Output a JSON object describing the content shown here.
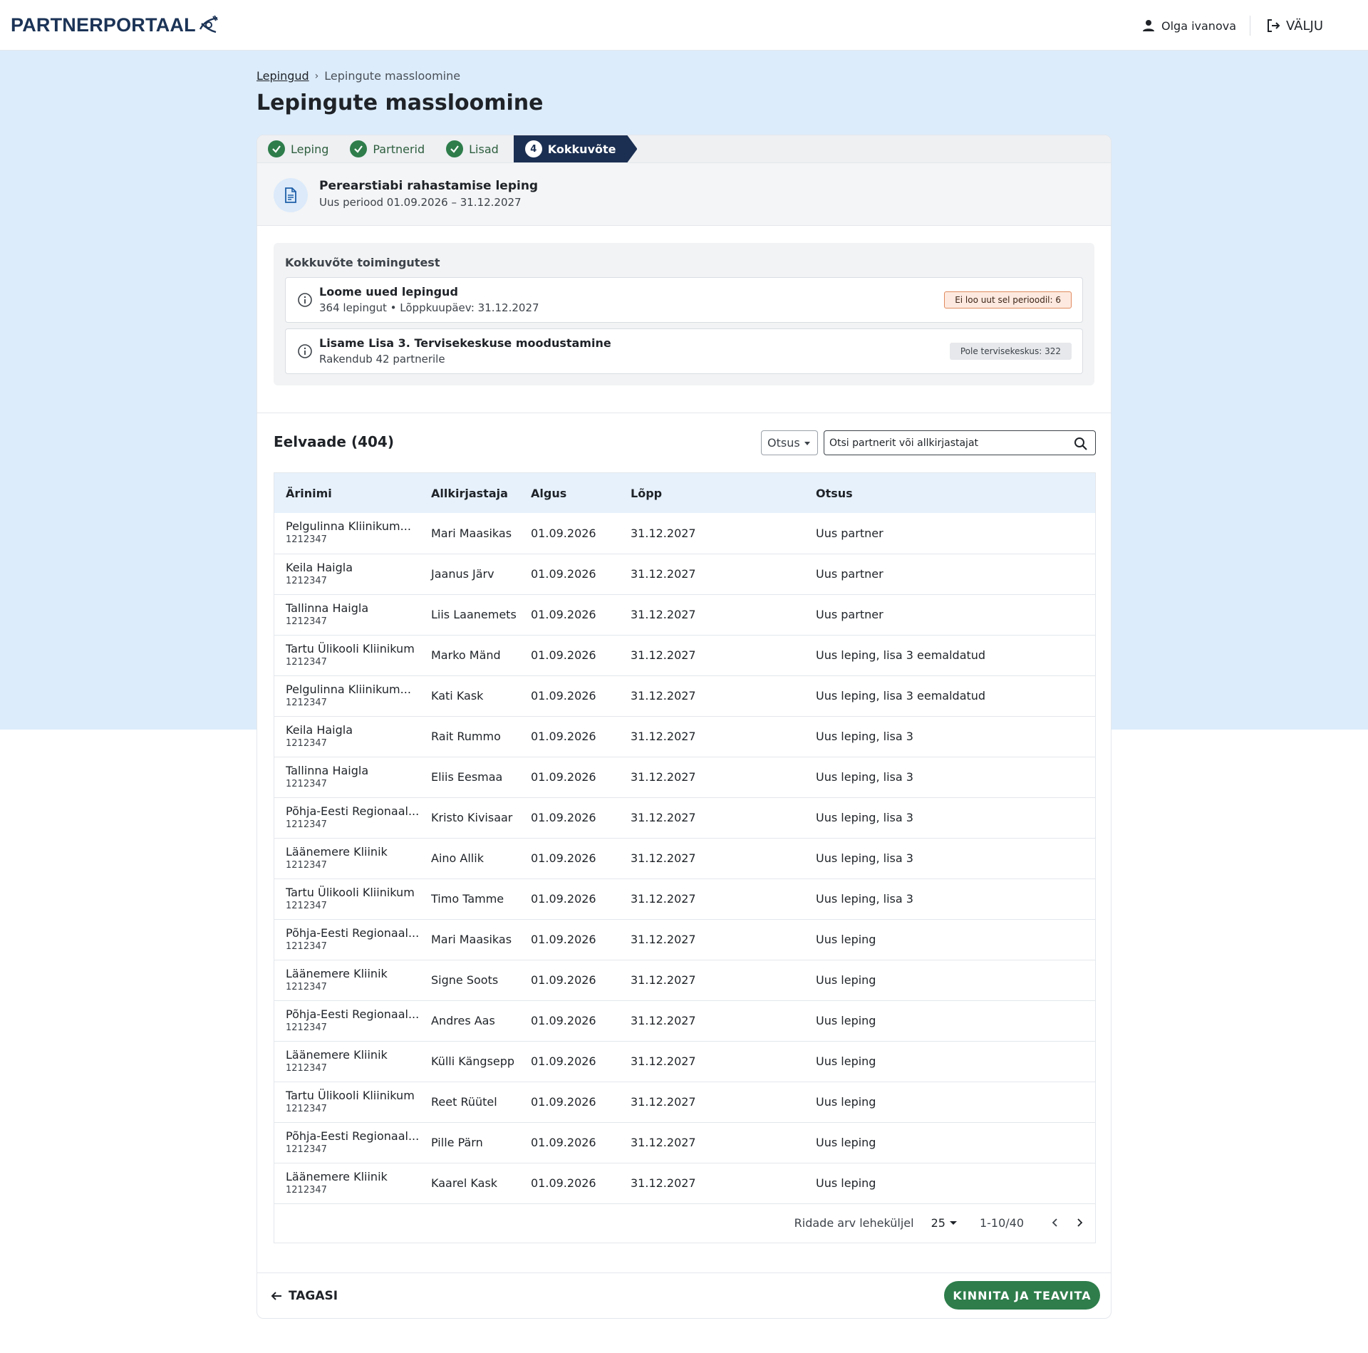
{
  "header": {
    "logo_text": "PARTNERPORTAAL",
    "user_name": "Olga ivanova",
    "logout_label": "VÄLJU"
  },
  "breadcrumb": {
    "parent": "Lepingud",
    "current": "Lepingute massloomine"
  },
  "page_title": "Lepingute massloomine",
  "stepper": {
    "steps": [
      {
        "label": "Leping",
        "state": "done"
      },
      {
        "label": "Partnerid",
        "state": "done"
      },
      {
        "label": "Lisad",
        "state": "done"
      },
      {
        "label": "Kokkuvõte",
        "state": "active",
        "number": "4"
      }
    ]
  },
  "contract": {
    "title": "Perearstiabi rahastamise leping",
    "period": "Uus periood 01.09.2026 – 31.12.2027"
  },
  "summary": {
    "title": "Kokkuvõte toimingutest",
    "items": [
      {
        "title": "Loome uued lepingud",
        "subtitle": "364 lepingut • Lõppkuupäev: 31.12.2027",
        "badge": "Ei loo uut sel perioodil: 6",
        "badge_type": "warn"
      },
      {
        "title": "Lisame Lisa 3. Tervisekeskuse moodustamine",
        "subtitle": "Rakendub 42 partnerile",
        "badge": "Pole tervisekeskus: 322",
        "badge_type": "neutral"
      }
    ]
  },
  "preview": {
    "title": "Eelvaade (404)",
    "filter_label": "Otsus",
    "search_placeholder": "Otsi partnerit või allkirjastajat"
  },
  "table": {
    "columns": [
      "Ärinimi",
      "Allkirjastaja",
      "Algus",
      "Lõpp",
      "Otsus"
    ],
    "rows": [
      {
        "name": "Pelgulinna Kliinikum...",
        "code": "1212347",
        "signer": "Mari Maasikas",
        "start": "01.09.2026",
        "end": "31.12.2027",
        "decision": "Uus partner"
      },
      {
        "name": "Keila Haigla",
        "code": "1212347",
        "signer": "Jaanus Järv",
        "start": "01.09.2026",
        "end": "31.12.2027",
        "decision": "Uus partner"
      },
      {
        "name": "Tallinna Haigla",
        "code": "1212347",
        "signer": "Liis Laanemets",
        "start": "01.09.2026",
        "end": "31.12.2027",
        "decision": "Uus partner"
      },
      {
        "name": "Tartu Ülikooli Kliinikum",
        "code": "1212347",
        "signer": "Marko Mänd",
        "start": "01.09.2026",
        "end": "31.12.2027",
        "decision": "Uus leping, lisa 3 eemaldatud"
      },
      {
        "name": "Pelgulinna Kliinikum...",
        "code": "1212347",
        "signer": "Kati Kask",
        "start": "01.09.2026",
        "end": "31.12.2027",
        "decision": "Uus leping, lisa 3 eemaldatud"
      },
      {
        "name": "Keila Haigla",
        "code": "1212347",
        "signer": "Rait Rummo",
        "start": "01.09.2026",
        "end": "31.12.2027",
        "decision": "Uus leping, lisa 3"
      },
      {
        "name": "Tallinna Haigla",
        "code": "1212347",
        "signer": "Eliis Eesmaa",
        "start": "01.09.2026",
        "end": "31.12.2027",
        "decision": "Uus leping, lisa 3"
      },
      {
        "name": "Põhja-Eesti Regionaal...",
        "code": "1212347",
        "signer": "Kristo Kivisaar",
        "start": "01.09.2026",
        "end": "31.12.2027",
        "decision": "Uus leping, lisa 3"
      },
      {
        "name": "Läänemere Kliinik",
        "code": "1212347",
        "signer": "Aino Allik",
        "start": "01.09.2026",
        "end": "31.12.2027",
        "decision": "Uus leping, lisa 3"
      },
      {
        "name": "Tartu Ülikooli Kliinikum",
        "code": "1212347",
        "signer": "Timo Tamme",
        "start": "01.09.2026",
        "end": "31.12.2027",
        "decision": "Uus leping, lisa 3"
      },
      {
        "name": "Põhja-Eesti Regionaal...",
        "code": "1212347",
        "signer": "Mari Maasikas",
        "start": "01.09.2026",
        "end": "31.12.2027",
        "decision": "Uus leping"
      },
      {
        "name": "Läänemere Kliinik",
        "code": "1212347",
        "signer": "Signe Soots",
        "start": "01.09.2026",
        "end": "31.12.2027",
        "decision": "Uus leping"
      },
      {
        "name": "Põhja-Eesti Regionaal...",
        "code": "1212347",
        "signer": "Andres Aas",
        "start": "01.09.2026",
        "end": "31.12.2027",
        "decision": "Uus leping"
      },
      {
        "name": "Läänemere Kliinik",
        "code": "1212347",
        "signer": "Külli Kängsepp",
        "start": "01.09.2026",
        "end": "31.12.2027",
        "decision": "Uus leping"
      },
      {
        "name": "Tartu Ülikooli Kliinikum",
        "code": "1212347",
        "signer": "Reet Rüütel",
        "start": "01.09.2026",
        "end": "31.12.2027",
        "decision": "Uus leping"
      },
      {
        "name": "Põhja-Eesti Regionaal...",
        "code": "1212347",
        "signer": "Pille Pärn",
        "start": "01.09.2026",
        "end": "31.12.2027",
        "decision": "Uus leping"
      },
      {
        "name": "Läänemere Kliinik",
        "code": "1212347",
        "signer": "Kaarel Kask",
        "start": "01.09.2026",
        "end": "31.12.2027",
        "decision": "Uus leping"
      }
    ]
  },
  "pagination": {
    "rows_label": "Ridade arv leheküljel",
    "rows_per_page": "25",
    "range": "1-10/40"
  },
  "footer": {
    "back_label": "TAGASI",
    "confirm_label": "KINNITA JA TEAVITA"
  },
  "colors": {
    "brand_navy": "#1b3356",
    "primary_green": "#2e7d4b",
    "hero_background": "#dcecfb",
    "warn_badge_border": "#e08a5e"
  },
  "icons": {
    "user": "person-icon",
    "logout": "logout-icon",
    "step_done": "check-icon",
    "contract": "document-icon",
    "summary_item": "info-icon",
    "search": "search-icon",
    "back": "arrow-left-icon",
    "pagination_prev": "chevron-left-icon",
    "pagination_next": "chevron-right-icon"
  }
}
